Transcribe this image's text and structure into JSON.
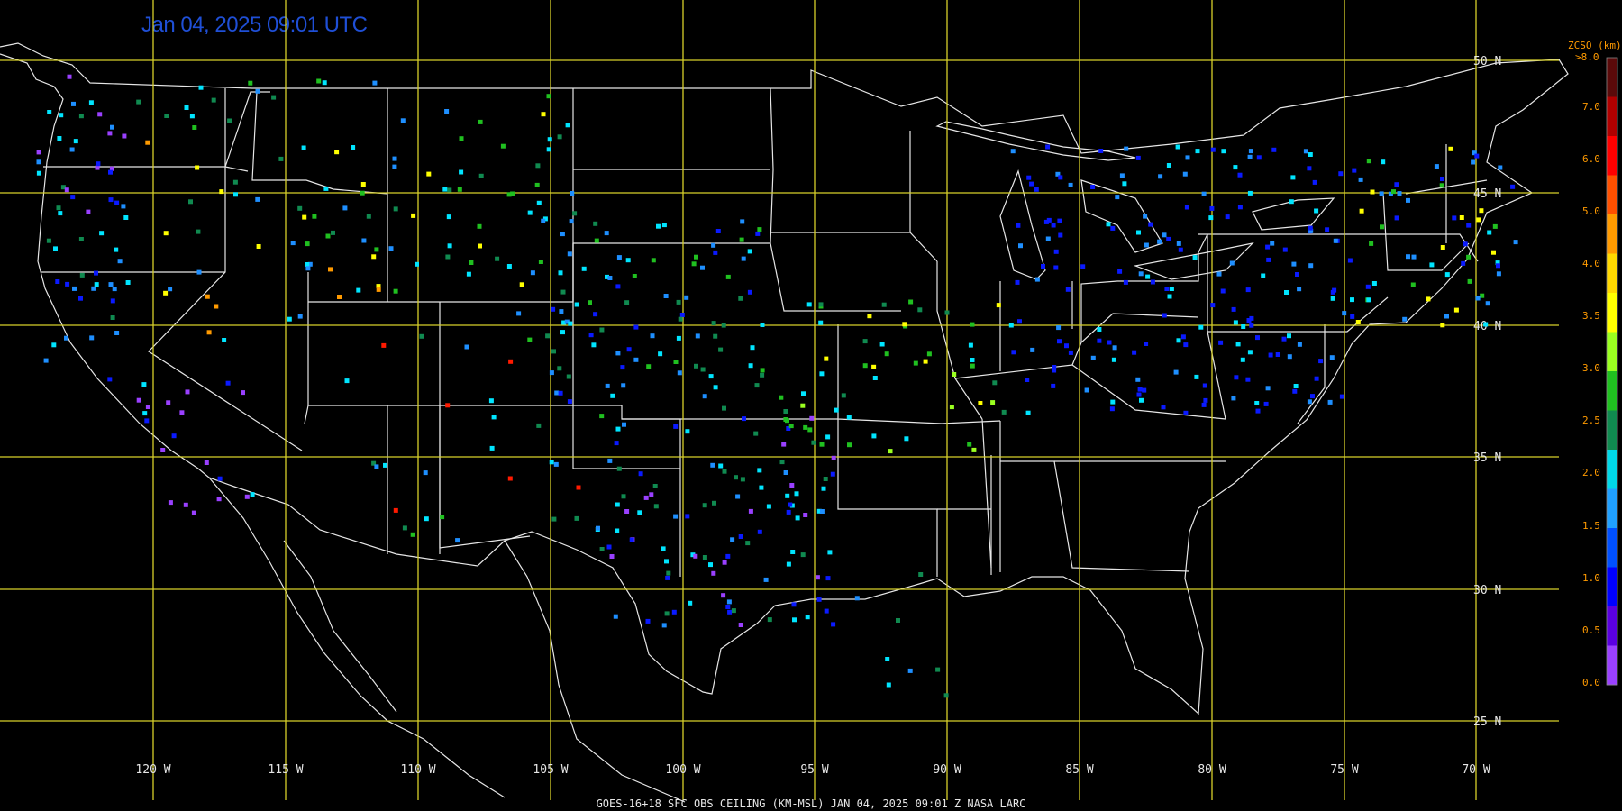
{
  "timestamp": "Jan 04, 2025 09:01 UTC",
  "footer": "GOES-16+18  SFC OBS CEILING (KM-MSL)   JAN 04, 2025 09:01 Z   NASA LARC",
  "lat_labels": [
    "50 N",
    "45 N",
    "40 N",
    "35 N",
    "30 N",
    "25 N"
  ],
  "lon_labels": [
    "120 W",
    "115 W",
    "110 W",
    "105 W",
    "100 W",
    "95 W",
    "90 W",
    "85 W",
    "80 W",
    "75 W",
    "70 W"
  ],
  "colorbar": {
    "title": "ZCSO (km)",
    "top_label": ">8.0",
    "tick_labels": [
      "7.0",
      "6.0",
      "5.0",
      "4.0",
      "3.5",
      "3.0",
      "2.5",
      "2.0",
      "1.5",
      "1.0",
      "0.5",
      "0.0"
    ],
    "colors": [
      "#5a0a0a",
      "#b00000",
      "#ff0000",
      "#ff5000",
      "#ff9a00",
      "#ffd800",
      "#ffff00",
      "#9aff20",
      "#20c020",
      "#108a50",
      "#00d8e8",
      "#20a0ff",
      "#0050ff",
      "#0000ff",
      "#5a00e0",
      "#9a40ff"
    ]
  },
  "colors": {
    "grid": "#d6cf2a",
    "boundary": "#e6e6e6",
    "background": "#000000",
    "timestamp": "#1f4fd6"
  },
  "station_color_key": [
    "violet",
    "blue",
    "azure",
    "cyan",
    "teal",
    "green",
    "lime",
    "yellow",
    "orange",
    "red",
    "darkred"
  ]
}
